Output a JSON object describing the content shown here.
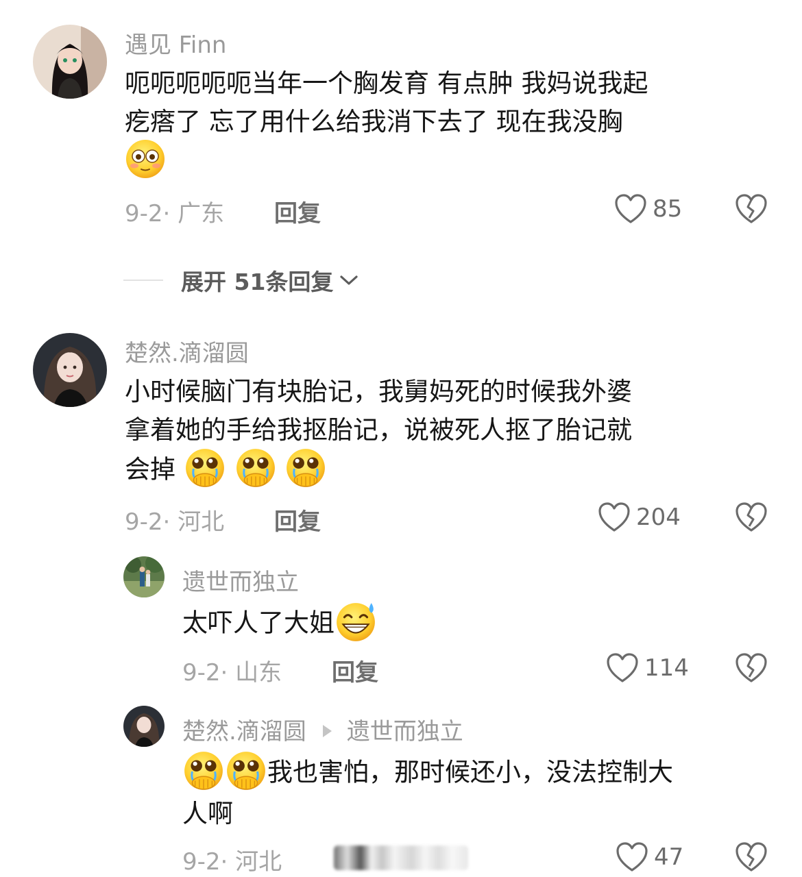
{
  "comments": [
    {
      "username": "遇见 Finn",
      "text_lines": [
        "呃呃呃呃呃当年一个胸发育 有点肿 我妈说我起",
        "疙瘩了 忘了用什么给我消下去了 现在我没胸"
      ],
      "emoji": "flushed-face",
      "date_location": "9-2· 广东",
      "reply_label": "回复",
      "likes": "85"
    },
    {
      "username": "楚然.滴溜圆",
      "text_lines": [
        "小时候脑门有块胎记，我舅妈死的时候我外婆",
        "拿着她的手给我抠胎记，说被死人抠了胎记就",
        "会掉"
      ],
      "emoji": "crying-face-hands",
      "date_location": "9-2· 河北",
      "reply_label": "回复",
      "likes": "204"
    }
  ],
  "replies": [
    {
      "username": "遗世而独立",
      "text": "太吓人了大姐",
      "emoji": "grinning-sweat-face",
      "date_location": "9-2· 山东",
      "reply_label": "回复",
      "likes": "114"
    },
    {
      "username": "楚然.滴溜圆",
      "reply_to": "遗世而独立",
      "text_line1": "我也害怕，那时候还小，没法控制大",
      "text_line2": "人啊",
      "emoji": "crying-face-hands",
      "date_location": "9-2· 河北",
      "likes": "47"
    }
  ],
  "expand": {
    "label": "展开 51条回复"
  },
  "colors": {
    "username": "#9a9a9a",
    "body": "#161616",
    "meta": "#a5a5a5",
    "accent_icon": "#6b6b6b"
  }
}
